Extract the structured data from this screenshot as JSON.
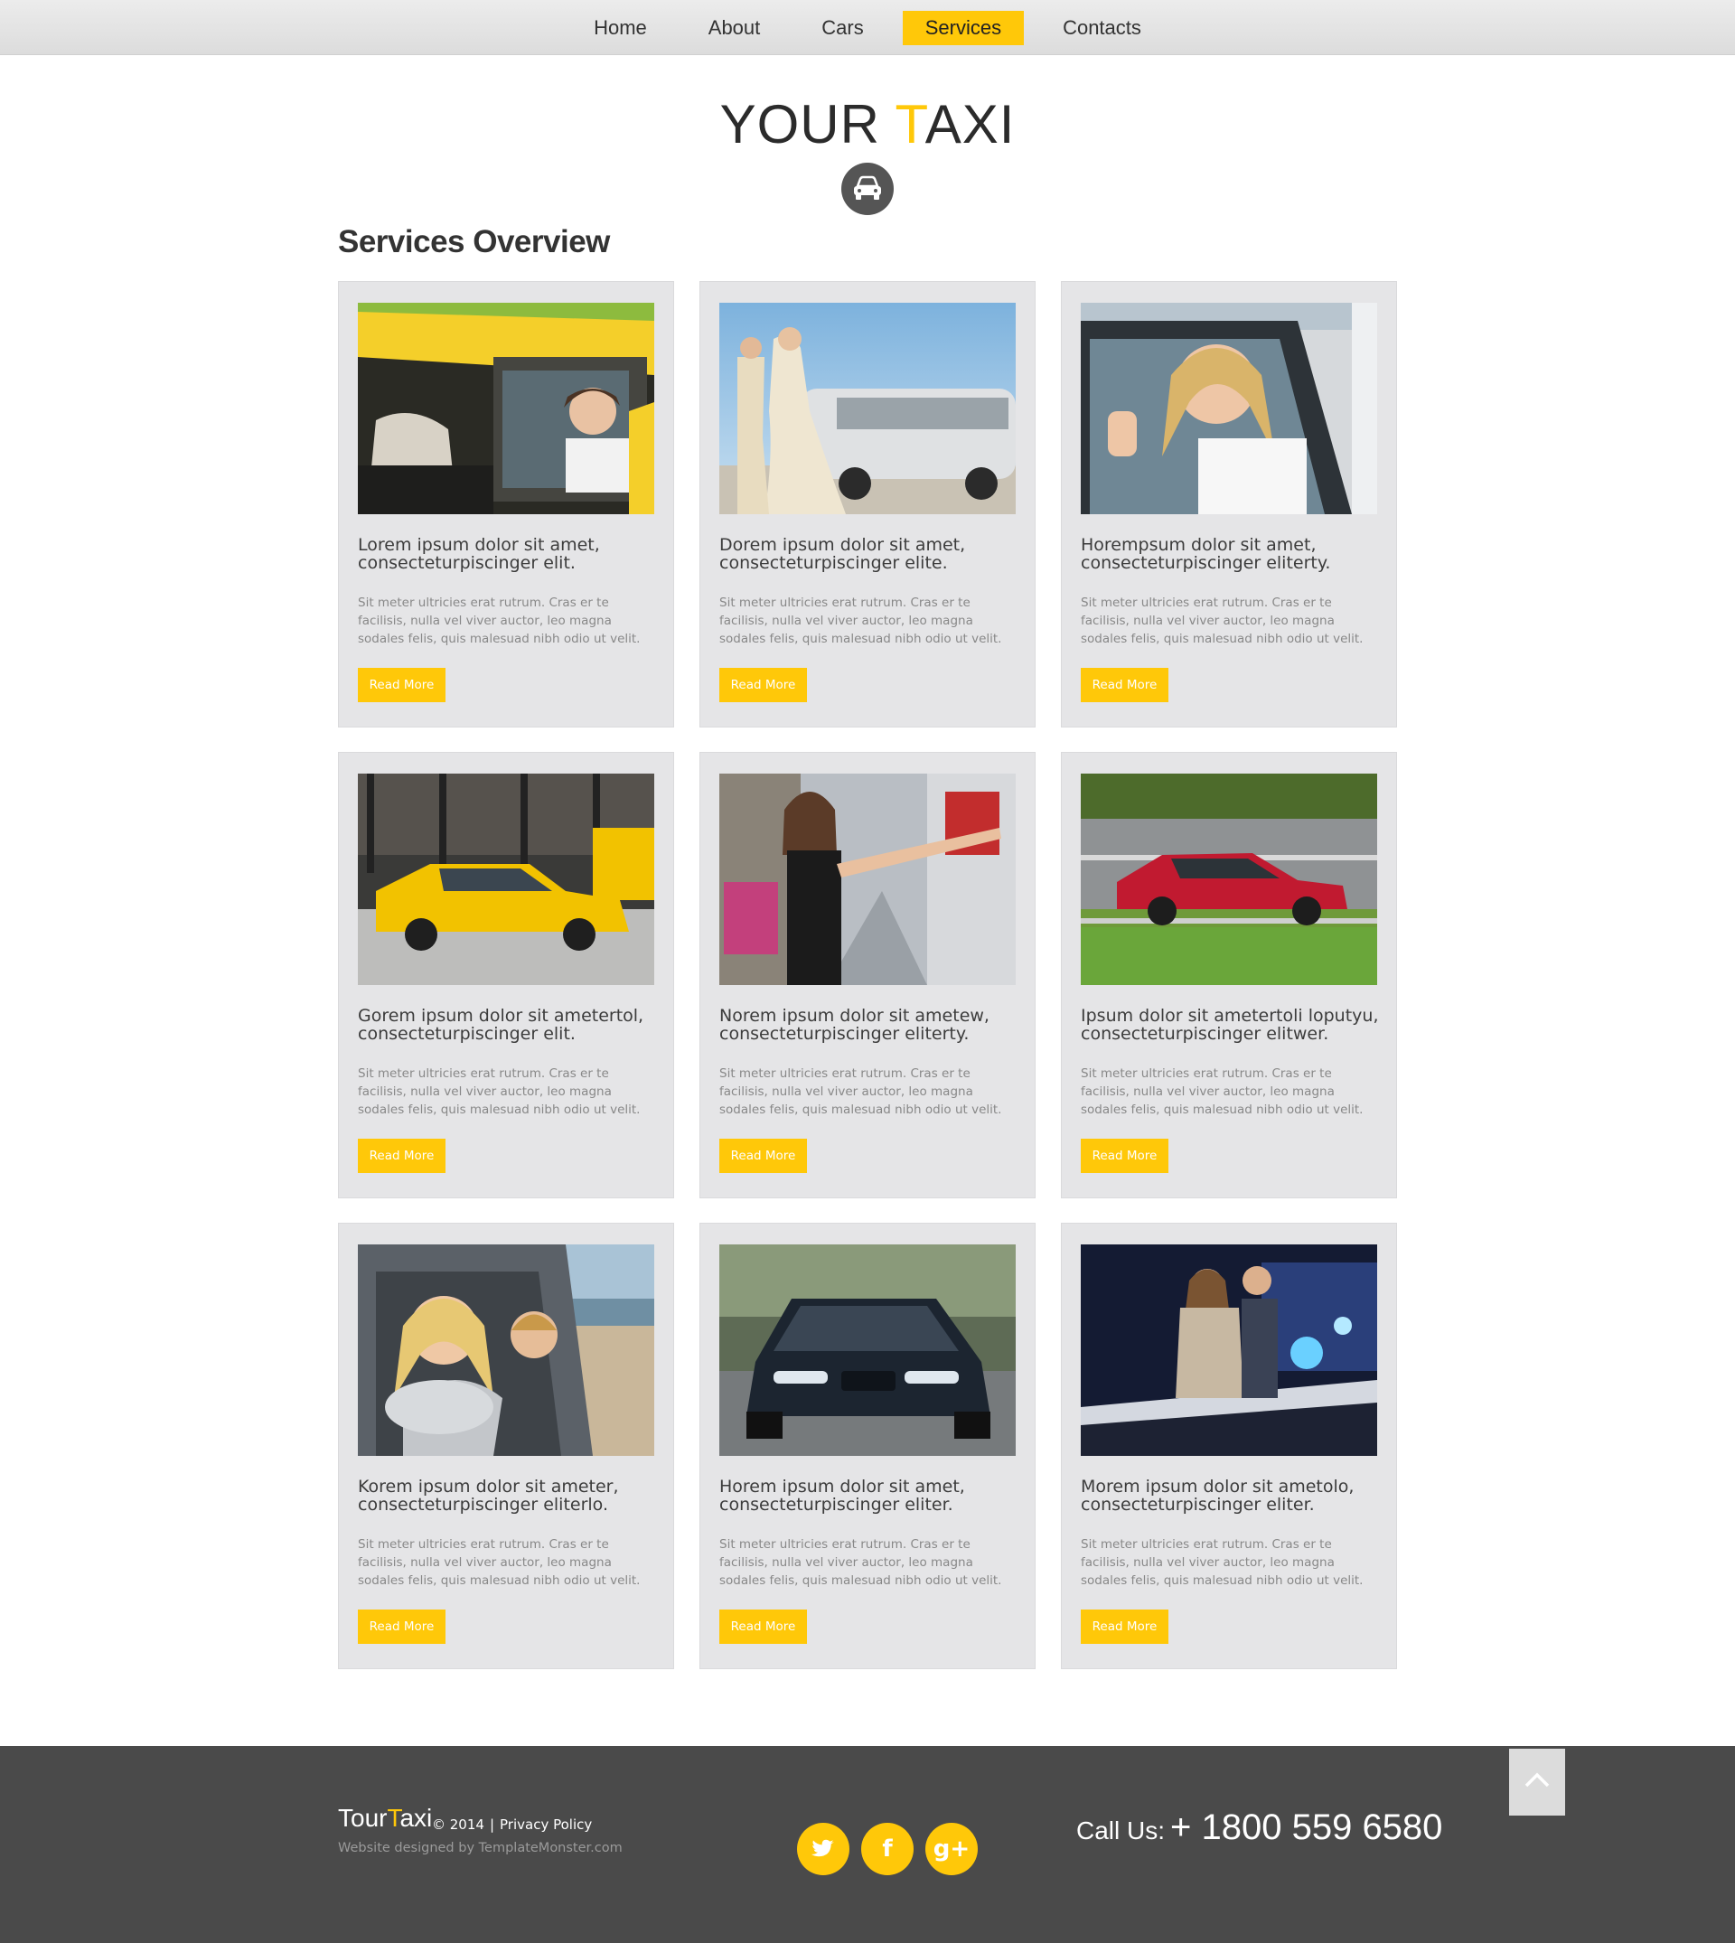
{
  "nav": {
    "items": [
      {
        "label": "Home",
        "active": false
      },
      {
        "label": "About",
        "active": false
      },
      {
        "label": "Cars",
        "active": false
      },
      {
        "label": "Services",
        "active": true
      },
      {
        "label": "Contacts",
        "active": false
      }
    ]
  },
  "header": {
    "logo_part1": "YOUR ",
    "logo_accent": "T",
    "logo_part2": "AXI",
    "badge_icon": "car-icon"
  },
  "section": {
    "title": "Services Overview"
  },
  "cards": [
    {
      "photo": "taxi-driver-photo",
      "title": "Lorem ipsum dolor sit amet, consecteturpiscinger elit.",
      "text": "Sit meter ultricies erat rutrum. Cras er te facilisis, nulla vel viver auctor, leo magna sodales felis, quis malesuad nibh odio ut velit.",
      "button": "Read More"
    },
    {
      "photo": "wedding-limo-photo",
      "title": "Dorem ipsum dolor sit amet, consecteturpiscinger elite.",
      "text": "Sit meter ultricies erat rutrum. Cras er te facilisis, nulla vel viver auctor, leo magna sodales felis, quis malesuad nibh odio ut velit.",
      "button": "Read More"
    },
    {
      "photo": "happy-driver-photo",
      "title": "Horempsum dolor sit amet, consecteturpiscinger eliterty.",
      "text": "Sit meter ultricies erat rutrum. Cras er te facilisis, nulla vel viver auctor, leo magna sodales felis, quis malesuad nibh odio ut velit.",
      "button": "Read More"
    },
    {
      "photo": "city-taxi-photo",
      "title": "Gorem ipsum dolor sit ametertol, consecteturpiscinger elit.",
      "text": "Sit meter ultricies erat rutrum. Cras er te facilisis, nulla vel viver auctor, leo magna sodales felis, quis malesuad nibh odio ut velit.",
      "button": "Read More"
    },
    {
      "photo": "hailing-taxi-photo",
      "title": "Norem ipsum dolor sit ametew, consecteturpiscinger eliterty.",
      "text": "Sit meter ultricies erat rutrum. Cras er te facilisis, nulla vel viver auctor, leo magna sodales felis, quis malesuad nibh odio ut velit.",
      "button": "Read More"
    },
    {
      "photo": "red-car-photo",
      "title": "Ipsum dolor sit ametertoli loputyu, consecteturpiscinger elitwer.",
      "text": "Sit meter ultricies erat rutrum. Cras er te facilisis, nulla vel viver auctor, leo magna sodales felis, quis malesuad nibh odio ut velit.",
      "button": "Read More"
    },
    {
      "photo": "family-car-photo",
      "title": "Korem ipsum dolor sit ameter, consecteturpiscinger eliterlo.",
      "text": "Sit meter ultricies erat rutrum. Cras er te facilisis, nulla vel viver auctor, leo magna sodales felis, quis malesuad nibh odio ut velit.",
      "button": "Read More"
    },
    {
      "photo": "black-bmw-photo",
      "title": "Horem ipsum dolor sit amet, consecteturpiscinger eliter.",
      "text": "Sit meter ultricies erat rutrum. Cras er te facilisis, nulla vel viver auctor, leo magna sodales felis, quis malesuad nibh odio ut velit.",
      "button": "Read More"
    },
    {
      "photo": "party-limo-photo",
      "title": "Morem ipsum dolor sit ametolo, consecteturpiscinger eliter.",
      "text": "Sit meter ultricies erat rutrum. Cras er te facilisis, nulla vel viver auctor, leo magna sodales felis, quis malesuad nibh odio ut velit.",
      "button": "Read More"
    }
  ],
  "footer": {
    "brand_part1": "Tour",
    "brand_accent": "T",
    "brand_part2": "axi",
    "copyright": "© 2014",
    "separator": "|",
    "privacy": "Privacy Policy",
    "designed_by": "Website designed by TemplateMonster.com",
    "socials": [
      {
        "icon": "twitter-icon"
      },
      {
        "icon": "facebook-icon",
        "glyph": "f"
      },
      {
        "icon": "google-plus-icon",
        "glyph": "g+"
      }
    ],
    "call_label": "Call Us:",
    "call_number": "+ 1800 559 6580",
    "back_to_top_icon": "chevron-up-icon"
  },
  "colors": {
    "accent": "#ffc809",
    "footer_bg": "#4a4a4a",
    "card_bg": "#e5e5e7",
    "text_dark": "#333333",
    "text_muted": "#888888"
  }
}
